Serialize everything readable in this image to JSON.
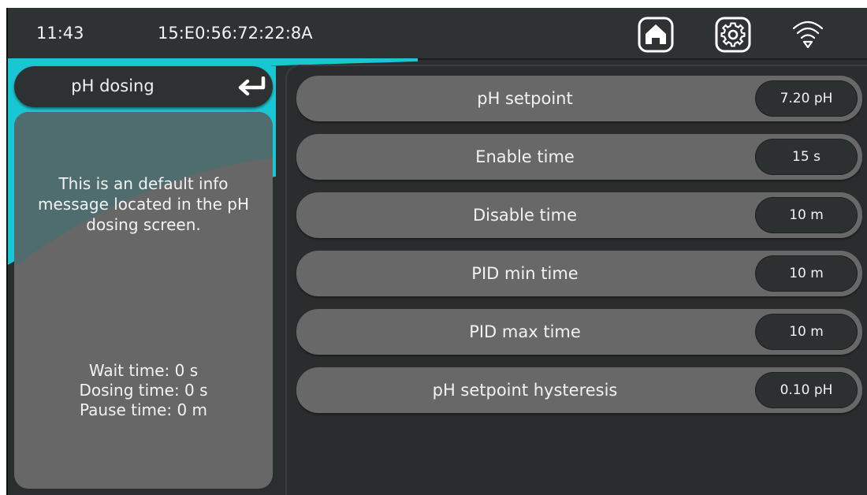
{
  "status_bar": {
    "time": "11:43",
    "device_id": "15:E0:56:72:22:8A",
    "icons": [
      "home-icon",
      "gear-icon",
      "wifi-icon"
    ]
  },
  "header": {
    "title": "pH dosing",
    "back_icon": "return-arrow-icon"
  },
  "info": {
    "message": "This is an default info message located in the pH dosing screen.",
    "stats": [
      "Wait time: 0 s",
      "Dosing time: 0 s",
      "Pause time: 0 m"
    ]
  },
  "settings": [
    {
      "label": "pH setpoint",
      "value": "7.20 pH"
    },
    {
      "label": "Enable time",
      "value": "15 s"
    },
    {
      "label": "Disable time",
      "value": "10 m"
    },
    {
      "label": "PID min time",
      "value": "10 m"
    },
    {
      "label": "PID max time",
      "value": "10 m"
    },
    {
      "label": "pH setpoint hysteresis",
      "value": "0.10 pH"
    }
  ],
  "colors": {
    "accent": "#19c7d4",
    "background": "#2b2e2f",
    "row": "#686868",
    "text": "#f2f2f2"
  }
}
